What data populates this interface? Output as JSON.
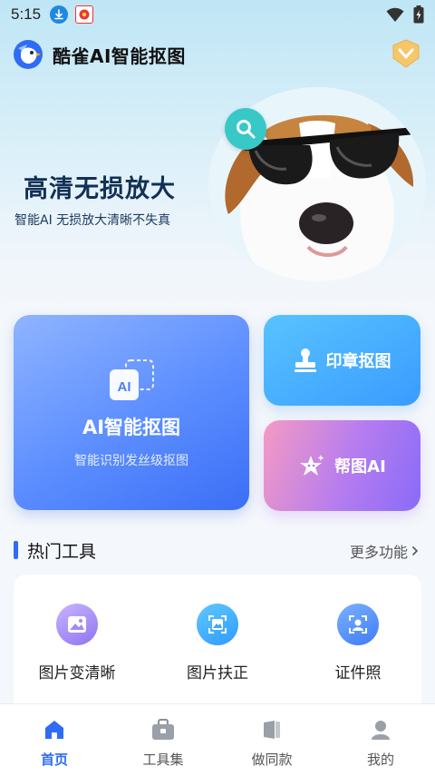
{
  "status_bar": {
    "time": "5:15",
    "icons": [
      "download-icon",
      "app-notification-icon",
      "wifi-icon",
      "battery-icon"
    ]
  },
  "header": {
    "title": "酷雀AI智能抠图",
    "logo_icon": "bird-logo-icon",
    "vip_icon": "vip-diamond-icon"
  },
  "banner": {
    "title": "高清无损放大",
    "subtitle": "智能AI  无损放大清晰不失真",
    "badge_icon": "magnifier-icon"
  },
  "features": {
    "ai_cutout": {
      "title": "AI智能抠图",
      "subtitle": "智能识别发丝级抠图",
      "icon": "ai-icon"
    },
    "stamp_cutout": {
      "label": "印章抠图",
      "icon": "stamp-icon"
    },
    "help_ai": {
      "label": "帮图AI",
      "icon": "sparkle-star-icon"
    }
  },
  "hot_tools": {
    "title": "热门工具",
    "more": "更多功能",
    "items": [
      {
        "label": "图片变清晰",
        "icon": "image-enhance-icon"
      },
      {
        "label": "图片扶正",
        "icon": "image-straighten-icon"
      },
      {
        "label": "证件照",
        "icon": "id-photo-icon"
      }
    ]
  },
  "bottom_nav": {
    "items": [
      {
        "label": "首页",
        "icon": "home-icon",
        "active": true
      },
      {
        "label": "工具集",
        "icon": "toolbox-icon",
        "active": false
      },
      {
        "label": "做同款",
        "icon": "template-icon",
        "active": false
      },
      {
        "label": "我的",
        "icon": "profile-icon",
        "active": false
      }
    ]
  },
  "colors": {
    "accent": "#2f6cf6",
    "teal": "#39c8c8",
    "card_blue": "#5b8dff",
    "card_sky": "#3a9cff",
    "card_pink": "#f59ac3"
  }
}
